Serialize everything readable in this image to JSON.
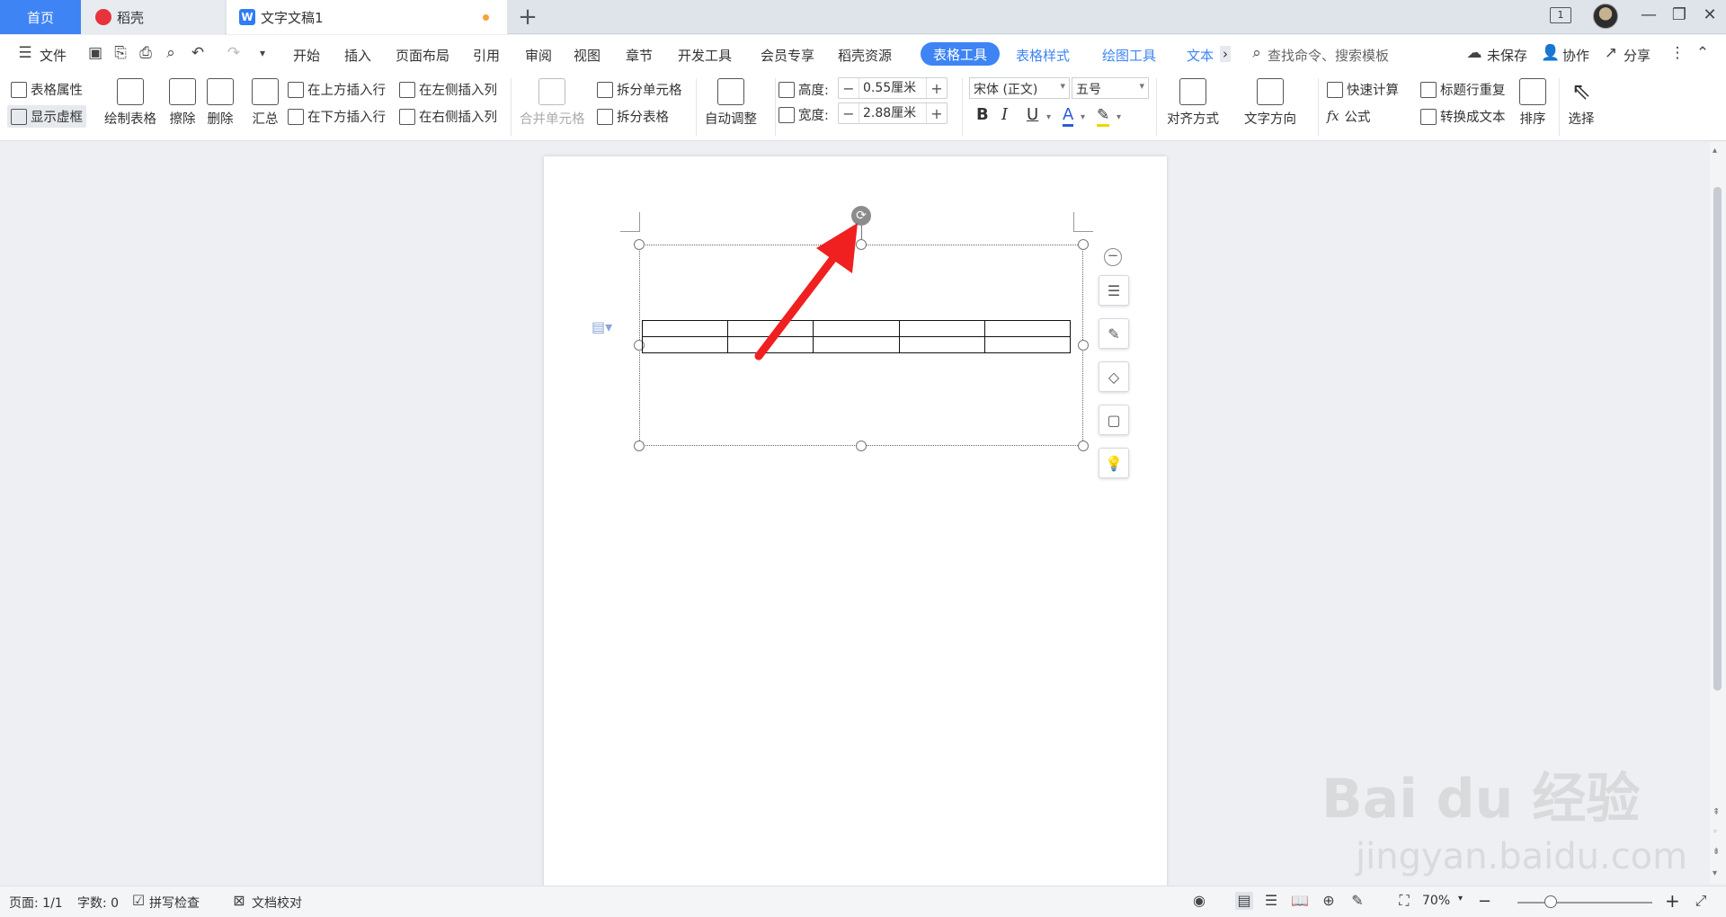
{
  "tabs": {
    "home": "首页",
    "daoke": "稻壳",
    "doc": "文字文稿1",
    "doc_icon": "W",
    "new_tab": "+"
  },
  "window": {
    "badge": "1",
    "minimize": "—",
    "restore": "❐",
    "close": "✕"
  },
  "menu": {
    "file": "文件",
    "items": [
      "开始",
      "插入",
      "页面布局",
      "引用",
      "审阅",
      "视图",
      "章节",
      "开发工具",
      "会员专享",
      "稻壳资源"
    ],
    "active": "表格工具",
    "context_items": [
      "表格样式",
      "绘图工具",
      "文本"
    ],
    "more": "›",
    "search_placeholder": "查找命令、搜索模板",
    "unsaved": "未保存",
    "collab": "协作",
    "share": "分享"
  },
  "ribbon": {
    "table_props": "表格属性",
    "show_gridlines": "显示虚框",
    "draw_table": "绘制表格",
    "erase": "擦除",
    "delete": "删除",
    "summary": "汇总",
    "insert_above": "在上方插入行",
    "insert_below": "在下方插入行",
    "insert_left": "在左侧插入列",
    "insert_right": "在右侧插入列",
    "merge_cells": "合并单元格",
    "split_cells": "拆分单元格",
    "split_table": "拆分表格",
    "auto_fit": "自动调整",
    "height_label": "高度:",
    "height_value": "0.55厘米",
    "width_label": "宽度:",
    "width_value": "2.88厘米",
    "font_name": "宋体 (正文)",
    "font_size": "五号",
    "bold": "B",
    "italic": "I",
    "underline": "U",
    "font_color": "A",
    "align": "对齐方式",
    "text_direction": "文字方向",
    "quick_calc": "快速计算",
    "formula": "公式",
    "repeat_header": "标题行重复",
    "to_text": "转换成文本",
    "sort": "排序",
    "select": "选择"
  },
  "document": {
    "table_rows": 2,
    "table_cols": 5
  },
  "status": {
    "page": "页面: 1/1",
    "word_count": "字数: 0",
    "spell_check": "拼写检查",
    "doc_proof": "文档校对",
    "zoom": "70%",
    "zoom_minus": "−",
    "zoom_plus": "+"
  },
  "watermark": {
    "main": "Bai du 经验",
    "sub": "jingyan.baidu.com"
  },
  "colors": {
    "accent": "#3e84f4",
    "arrow": "#f02020"
  }
}
